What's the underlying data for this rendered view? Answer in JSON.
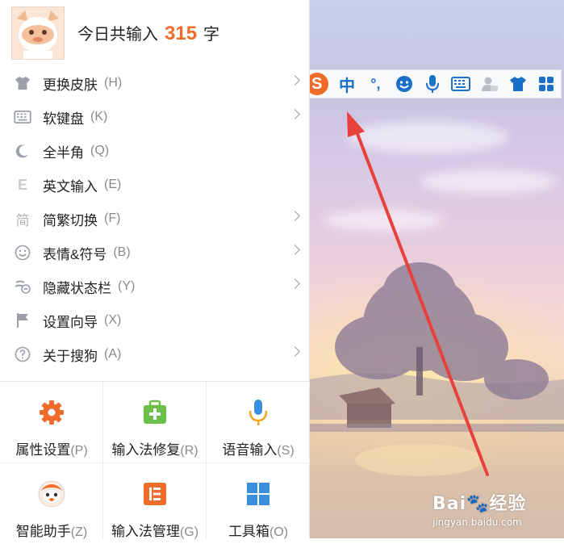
{
  "header": {
    "prefix": "今日共输入",
    "count": "315",
    "suffix": "字"
  },
  "menu_items": [
    {
      "label": "更换皮肤",
      "key": "(H)",
      "icon": "shirt-icon",
      "has_submenu": true
    },
    {
      "label": "软键盘",
      "key": "(K)",
      "icon": "keyboard-icon",
      "has_submenu": true
    },
    {
      "label": "全半角",
      "key": "(Q)",
      "icon": "moon-icon",
      "has_submenu": false
    },
    {
      "label": "英文输入",
      "key": "(E)",
      "icon": "letter-e-icon",
      "has_submenu": false
    },
    {
      "label": "简繁切换",
      "key": "(F)",
      "icon": "simplified-char-icon",
      "has_submenu": true
    },
    {
      "label": "表情&符号",
      "key": "(B)",
      "icon": "smiley-icon",
      "has_submenu": true
    },
    {
      "label": "隐藏状态栏",
      "key": "(Y)",
      "icon": "hide-statusbar-icon",
      "has_submenu": true
    },
    {
      "label": "设置向导",
      "key": "(X)",
      "icon": "flag-icon",
      "has_submenu": false
    },
    {
      "label": "关于搜狗",
      "key": "(A)",
      "icon": "help-icon",
      "has_submenu": true
    }
  ],
  "icon_glyphs": {
    "simplified": "简",
    "letter_e": "E"
  },
  "grid_items": [
    {
      "label": "属性设置",
      "key": "(P)",
      "icon": "gear-icon"
    },
    {
      "label": "输入法修复",
      "key": "(R)",
      "icon": "repair-kit-icon"
    },
    {
      "label": "语音输入",
      "key": "(S)",
      "icon": "microphone-icon"
    },
    {
      "label": "智能助手",
      "key": "(Z)",
      "icon": "assistant-icon"
    },
    {
      "label": "输入法管理",
      "key": "(G)",
      "icon": "manage-icon"
    },
    {
      "label": "工具箱",
      "key": "(O)",
      "icon": "toolbox-icon"
    }
  ],
  "toolbar": {
    "logo": "S",
    "lang": "中",
    "punct": "°,",
    "buttons": [
      "sogou-logo-icon",
      "chinese-mode-icon",
      "punctuation-icon",
      "emoji-icon",
      "microphone-icon",
      "keyboard-icon",
      "user-card-icon",
      "skin-shirt-icon",
      "toolbox-icon"
    ]
  },
  "watermark": {
    "brand": "Bai🐾经验",
    "url": "jingyan.baidu.com"
  },
  "colors": {
    "accent_orange": "#ef6c2a",
    "toolbar_blue": "#1a6fc7",
    "arrow_red": "#e8403a",
    "grid_blue": "#3a8fdc",
    "grid_green": "#6cc04a"
  }
}
